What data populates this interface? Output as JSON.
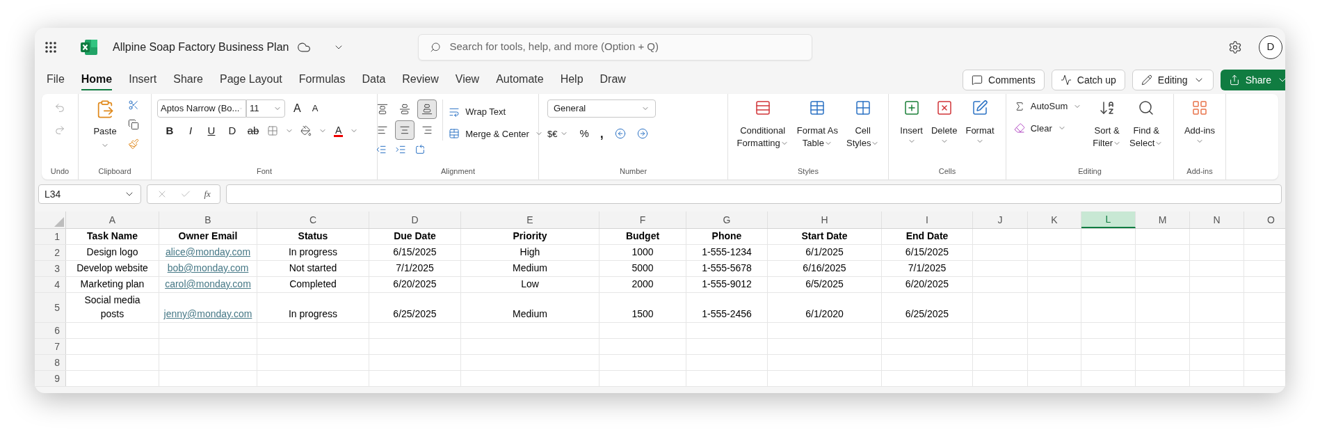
{
  "app": {
    "document_title": "Allpine Soap Factory Business Plan",
    "search_placeholder": "Search for tools, help, and more (Option + Q)",
    "avatar_initial": "D"
  },
  "menu_tabs": [
    {
      "label": "File",
      "selected": false
    },
    {
      "label": "Home",
      "selected": true
    },
    {
      "label": "Insert",
      "selected": false
    },
    {
      "label": "Share",
      "selected": false
    },
    {
      "label": "Page Layout",
      "selected": false
    },
    {
      "label": "Formulas",
      "selected": false
    },
    {
      "label": "Data",
      "selected": false
    },
    {
      "label": "Review",
      "selected": false
    },
    {
      "label": "View",
      "selected": false
    },
    {
      "label": "Automate",
      "selected": false
    },
    {
      "label": "Help",
      "selected": false
    },
    {
      "label": "Draw",
      "selected": false
    }
  ],
  "actions": [
    {
      "label": "Comments",
      "kind": "comments"
    },
    {
      "label": "Catch up",
      "kind": "catchup"
    },
    {
      "label": "Editing",
      "kind": "editing"
    },
    {
      "label": "Share",
      "kind": "share"
    }
  ],
  "ribbon": {
    "undo": {
      "label": "Undo"
    },
    "clipboard": {
      "label": "Clipboard",
      "paste": "Paste"
    },
    "font": {
      "label": "Font",
      "font_name": "Aptos Narrow (Bo...",
      "font_size": "11",
      "grow": "A",
      "shrink": "A",
      "styles": [
        "B",
        "I",
        "U",
        "D",
        "ab"
      ],
      "font_color": "A"
    },
    "alignment": {
      "label": "Alignment",
      "vertical": [
        {
          "kind": "top",
          "selected": false
        },
        {
          "kind": "middle",
          "selected": false
        },
        {
          "kind": "bottom",
          "selected": true
        }
      ],
      "horizontal": [
        {
          "kind": "left",
          "selected": false
        },
        {
          "kind": "center",
          "selected": true
        },
        {
          "kind": "right",
          "selected": false
        }
      ],
      "wrap": "Wrap Text",
      "merge": "Merge & Center"
    },
    "number": {
      "label": "Number",
      "format": "General",
      "currency": "$€",
      "percent": "%",
      "comma": ","
    },
    "styles": {
      "label": "Styles",
      "buttons": [
        {
          "kind": "conditional",
          "lines": [
            "Conditional",
            "Formatting"
          ]
        },
        {
          "kind": "table",
          "lines": [
            "Format As",
            "Table"
          ]
        },
        {
          "kind": "cell_styles",
          "lines": [
            "Cell",
            "Styles"
          ]
        }
      ]
    },
    "cells": {
      "label": "Cells",
      "buttons": [
        {
          "kind": "insert",
          "label": "Insert"
        },
        {
          "kind": "delete",
          "label": "Delete"
        },
        {
          "kind": "format",
          "label": "Format"
        }
      ]
    },
    "editing": {
      "label": "Editing",
      "autosum": "AutoSum",
      "clear": "Clear",
      "buttons": [
        {
          "kind": "sort",
          "lines": [
            "Sort &",
            "Filter"
          ]
        },
        {
          "kind": "find",
          "lines": [
            "Find &",
            "Select"
          ]
        }
      ]
    },
    "addins": {
      "label": "Add-ins",
      "button": "Add-ins"
    }
  },
  "formula_bar": {
    "name_box": "L34",
    "function_label": "fx"
  },
  "sheet": {
    "columns": [
      {
        "letter": "A",
        "kind": "text",
        "selected": false
      },
      {
        "letter": "B",
        "kind": "link",
        "selected": false
      },
      {
        "letter": "C",
        "kind": "text",
        "selected": false
      },
      {
        "letter": "D",
        "kind": "text",
        "selected": false
      },
      {
        "letter": "E",
        "kind": "text",
        "selected": false
      },
      {
        "letter": "F",
        "kind": "text",
        "selected": false
      },
      {
        "letter": "G",
        "kind": "text",
        "selected": false
      },
      {
        "letter": "H",
        "kind": "text",
        "selected": false
      },
      {
        "letter": "I",
        "kind": "text",
        "selected": false
      },
      {
        "letter": "J",
        "kind": "text",
        "selected": false
      },
      {
        "letter": "K",
        "kind": "text",
        "selected": false
      },
      {
        "letter": "L",
        "kind": "text",
        "selected": true
      },
      {
        "letter": "M",
        "kind": "text",
        "selected": false
      },
      {
        "letter": "N",
        "kind": "text",
        "selected": false
      },
      {
        "letter": "O",
        "kind": "text",
        "selected": false
      }
    ],
    "rows": [
      {
        "number": "1",
        "kind": "header",
        "cells": [
          "Task Name",
          "Owner Email",
          "Status",
          "Due Date",
          "Priority",
          "Budget",
          "Phone",
          "Start Date",
          "End Date"
        ]
      },
      {
        "number": "2",
        "kind": "data",
        "cells": [
          "Design logo",
          "alice@monday.com",
          "In progress",
          "6/15/2025",
          "High",
          "1000",
          "1-555-1234",
          "6/1/2025",
          "6/15/2025"
        ]
      },
      {
        "number": "3",
        "kind": "data",
        "cells": [
          "Develop website",
          "bob@monday.com",
          "Not started",
          "7/1/2025",
          "Medium",
          "5000",
          "1-555-5678",
          "6/16/2025",
          "7/1/2025"
        ]
      },
      {
        "number": "4",
        "kind": "data",
        "cells": [
          "Marketing plan",
          "carol@monday.com",
          "Completed",
          "6/20/2025",
          "Low",
          "2000",
          "1-555-9012",
          "6/5/2025",
          "6/20/2025"
        ]
      },
      {
        "number": "5",
        "kind": "data",
        "cells": [
          "Social media posts",
          "jenny@monday.com",
          "In progress",
          "6/25/2025",
          "Medium",
          "1500",
          "1-555-2456",
          "6/1/2020",
          "6/25/2025"
        ]
      },
      {
        "number": "6"
      },
      {
        "number": "7"
      },
      {
        "number": "8"
      },
      {
        "number": "9"
      }
    ]
  }
}
